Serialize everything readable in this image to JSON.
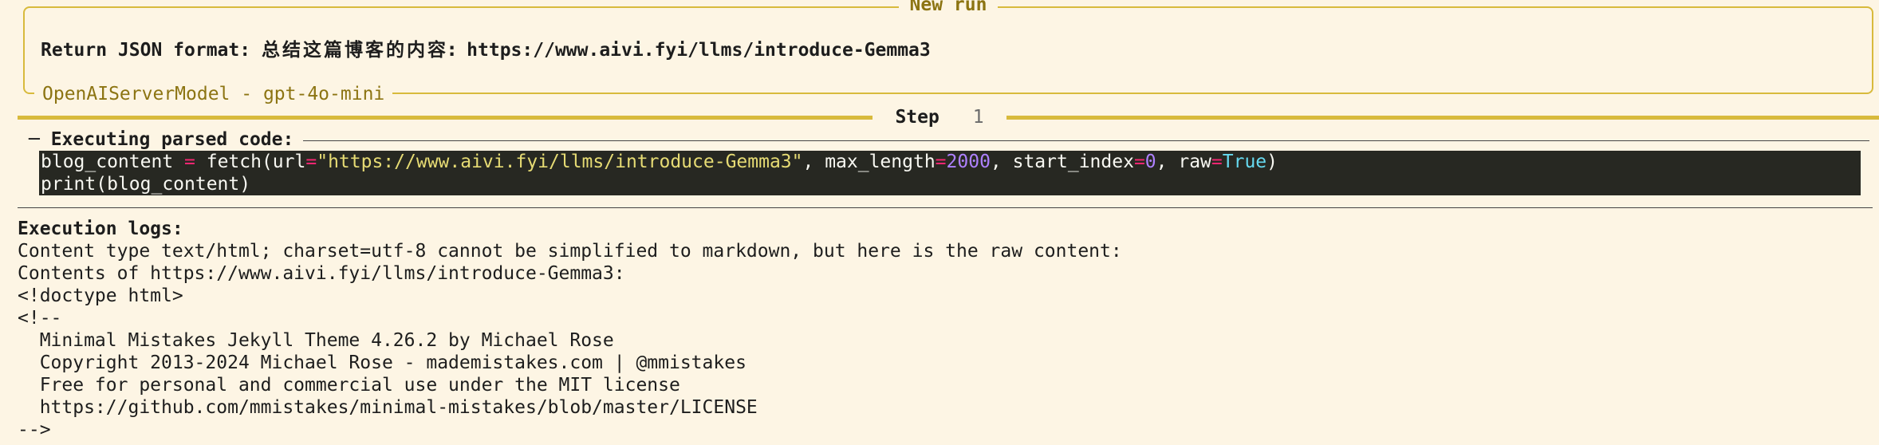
{
  "run_panel": {
    "title": "New run",
    "task_prefix": "Return JSON format: ",
    "task_cjk": "总结这篇博客的内容: ",
    "task_url": "https://www.aivi.fyi/llms/introduce-Gemma3",
    "model": "OpenAIServerModel - gpt-4o-mini"
  },
  "step": {
    "label": "Step",
    "number": "1"
  },
  "code_section": {
    "header": "Executing parsed code:",
    "line1": {
      "var": "blog_content ",
      "eq": "=",
      "call": " fetch(url",
      "eq2": "=",
      "url": "\"https://www.aivi.fyi/llms/introduce-Gemma3\"",
      "sep1": ", max_length",
      "eq3": "=",
      "max_length": "2000",
      "sep2": ", start_index",
      "eq4": "=",
      "start_index": "0",
      "sep3": ", raw",
      "eq5": "=",
      "raw": "True",
      "close": ")"
    },
    "line2": "print(blog_content)"
  },
  "logs": {
    "title": "Execution logs:",
    "lines": [
      "Content type text/html; charset=utf-8 cannot be simplified to markdown, but here is the raw content:",
      "Contents of https://www.aivi.fyi/llms/introduce-Gemma3:",
      "<!doctype html>",
      "<!--",
      "  Minimal Mistakes Jekyll Theme 4.26.2 by Michael Rose",
      "  Copyright 2013-2024 Michael Rose - mademistakes.com | @mmistakes",
      "  Free for personal and commercial use under the MIT license",
      "  https://github.com/mmistakes/minimal-mistakes/blob/master/LICENSE",
      "-->"
    ]
  },
  "colors": {
    "background": "#fdf5e4",
    "accent_gold": "#d8ba3c",
    "gold_text": "#8c7412",
    "code_bg": "#272822"
  }
}
